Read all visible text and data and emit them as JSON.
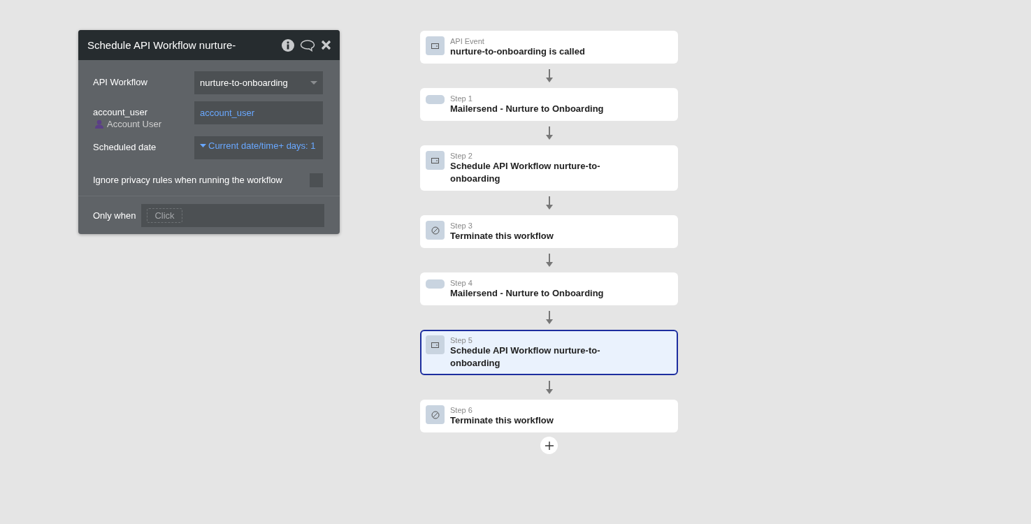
{
  "panel": {
    "title": "Schedule API Workflow nurture-",
    "fields": [
      {
        "kind": "dropdown",
        "label": "API Workflow",
        "value": "nurture-to-onboarding"
      },
      {
        "kind": "text",
        "label": "account_user",
        "sublabel": "Account User",
        "value": "account_user"
      },
      {
        "kind": "expression",
        "label": "Scheduled date",
        "value": "Current date/time+ days: 1"
      },
      {
        "kind": "checkbox",
        "label": "Ignore privacy rules when running the workflow",
        "checked": false
      }
    ],
    "only_when": {
      "label": "Only when",
      "placeholder": "Click"
    }
  },
  "workflow": {
    "steps": [
      {
        "kind": "event",
        "caption": "API Event",
        "title": "nurture-to-onboarding is called",
        "selected": false
      },
      {
        "kind": "plugin",
        "caption": "Step 1",
        "title": "Mailersend - Nurture to Onboarding",
        "selected": false
      },
      {
        "kind": "schedule",
        "caption": "Step 2",
        "title": "Schedule API Workflow nurture-to-onboarding",
        "selected": false
      },
      {
        "kind": "terminate",
        "caption": "Step 3",
        "title": "Terminate this workflow",
        "selected": false
      },
      {
        "kind": "plugin",
        "caption": "Step 4",
        "title": "Mailersend - Nurture to Onboarding",
        "selected": false
      },
      {
        "kind": "schedule",
        "caption": "Step 5",
        "title": "Schedule API Workflow nurture-to-onboarding",
        "selected": true
      },
      {
        "kind": "terminate",
        "caption": "Step 6",
        "title": "Terminate this workflow",
        "selected": false
      }
    ]
  }
}
